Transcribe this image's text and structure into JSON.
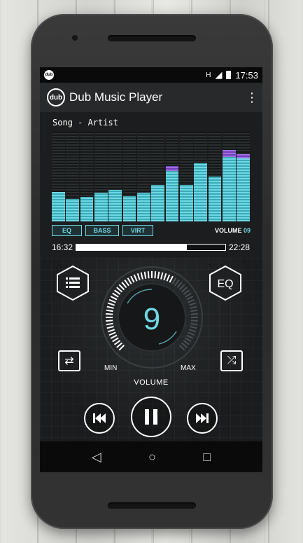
{
  "status_bar": {
    "app_badge": "dub",
    "signal": "H",
    "time": "17:53"
  },
  "app_bar": {
    "logo_text": "dub",
    "title": "Dub Music Player",
    "menu_icon": "overflow-menu-icon"
  },
  "visualizer": {
    "song_label": "Song - Artist",
    "bar_levels": [
      0.33,
      0.25,
      0.27,
      0.32,
      0.35,
      0.28,
      0.32,
      0.41,
      0.56,
      0.41,
      0.65,
      0.5,
      0.72,
      0.7
    ],
    "peak_levels": [
      0,
      0,
      0,
      0,
      0,
      0,
      0,
      0,
      0.06,
      0,
      0,
      0,
      0.08,
      0.05
    ],
    "effects": [
      {
        "label": "EQ"
      },
      {
        "label": "BASS"
      },
      {
        "label": "VIRT"
      }
    ],
    "volume_text": "VOLUME",
    "volume_value": "09",
    "colors": {
      "bar": "#6fd8e4",
      "peak": "#a070e0"
    }
  },
  "playback": {
    "elapsed": "16:32",
    "total": "22:28",
    "progress": 0.74
  },
  "controls": {
    "eq_label": "EQ",
    "dial_value": "9",
    "dial_level": 0.6,
    "min_label": "MIN",
    "max_label": "MAX",
    "volume_label": "VOLUME"
  }
}
